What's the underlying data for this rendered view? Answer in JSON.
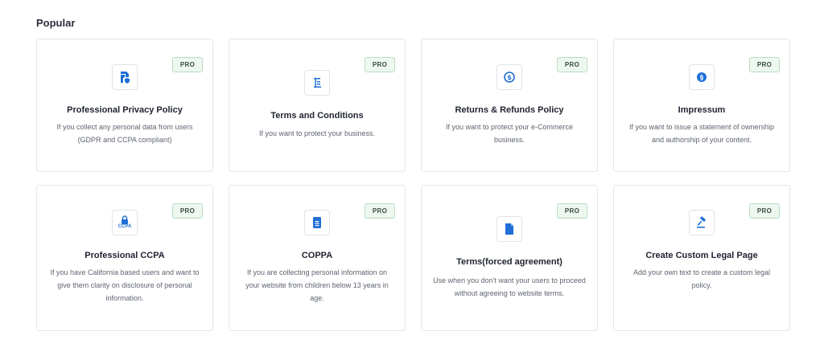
{
  "section": {
    "title": "Popular"
  },
  "badge": "PRO",
  "accent_color": "#1f6fd6",
  "cards": [
    {
      "title": "Professional Privacy Policy",
      "desc": "If you collect any personal data from users (GDPR and CCPA compliant)",
      "icon": "privacy-policy-icon"
    },
    {
      "title": "Terms and Conditions",
      "desc": "If you want to protect your business.",
      "icon": "scroll-icon"
    },
    {
      "title": "Returns & Refunds Policy",
      "desc": "If you want to protect your e-Commerce business.",
      "icon": "refund-icon"
    },
    {
      "title": "Impressum",
      "desc": "If you want to issue a statement of ownership and authorship of your content.",
      "icon": "section-sign-icon"
    },
    {
      "title": "Professional CCPA",
      "desc": "If you have California based users and want to give them clarity on disclosure of personal information.",
      "icon": "ccpa-lock-icon",
      "icon_text": "CCPA"
    },
    {
      "title": "COPPA",
      "desc": "If you are collecting personal information on your website from children below 13 years in age.",
      "icon": "document-icon"
    },
    {
      "title": "Terms(forced agreement)",
      "desc": "Use when you don't want your users to proceed without agreeing to website terms.",
      "icon": "file-icon"
    },
    {
      "title": "Create Custom Legal Page",
      "desc": "Add your own text to create a custom legal policy.",
      "icon": "gavel-icon"
    }
  ]
}
